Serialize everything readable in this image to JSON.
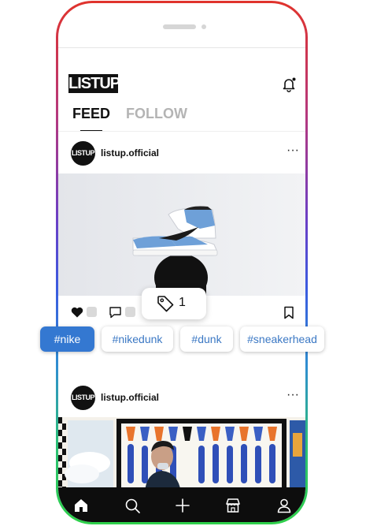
{
  "app": {
    "logo": "LISTUP",
    "colors": {
      "accent": "#3478d1",
      "inactive_tab": "#b4b4b4",
      "nav_bg": "#0d0d0d"
    }
  },
  "header": {
    "icons": {
      "notifications": "bell-icon"
    }
  },
  "tabs": [
    {
      "label": "FEED"
    },
    {
      "label": "FOLLOW"
    }
  ],
  "posts": [
    {
      "avatar_text": "LISTUP",
      "username": "listup.official",
      "more": "···"
    },
    {
      "avatar_text": "LISTUP",
      "username": "listup.official",
      "more": "···"
    }
  ],
  "tag_popup": {
    "count": "1"
  },
  "hashtags": [
    {
      "label": "#nike"
    },
    {
      "label": "#nikedunk"
    },
    {
      "label": "#dunk"
    },
    {
      "label": "#sneakerhead"
    }
  ],
  "bottom_nav": {
    "items": [
      "home-icon",
      "search-icon",
      "plus-icon",
      "store-icon",
      "profile-icon"
    ]
  }
}
